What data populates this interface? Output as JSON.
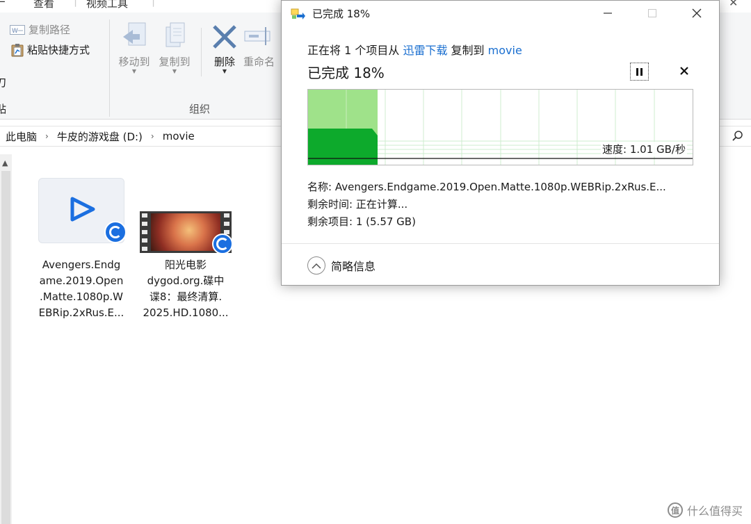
{
  "explorer": {
    "ribbon_tabs": [
      "查看",
      "视频工具"
    ],
    "ribbon": {
      "copy_path": "复制路径",
      "paste_shortcut": "粘贴快捷方式",
      "move_to": "移动到",
      "copy_to": "复制到",
      "delete": "删除",
      "rename": "重命名",
      "group_organize": "组织",
      "partial_left_1": "刀",
      "partial_left_2": "贴"
    },
    "breadcrumb": [
      "此电脑",
      "牛皮的游戏盘 (D:)",
      "movie"
    ],
    "files": [
      {
        "name": "Avengers.Endgame.2019.Open.Matte.1080p.WEBRip.2xRus.E...",
        "lines": [
          "Avengers.Endg",
          "ame.2019.Open",
          ".Matte.1080p.W",
          "EBRip.2xRus.E..."
        ],
        "icon": "media-player-play-icon"
      },
      {
        "name": "阳光电影dygod.org.碟中谍8：最终清算.2025.HD.1080...",
        "lines": [
          "阳光电影",
          "dygod.org.碟中",
          "谍8：最终清算.",
          "2025.HD.1080..."
        ],
        "icon": "video-thumbnail"
      }
    ]
  },
  "copy_dialog": {
    "title": "已完成 18%",
    "line_prefix": "正在将 1 个项目从 ",
    "source": "迅雷下载",
    "line_middle": " 复制到 ",
    "destination": "movie",
    "status": "已完成 18%",
    "percent": 18,
    "speed": "速度: 1.01 GB/秒",
    "name_label": "名称:",
    "name_value": "Avengers.Endgame.2019.Open.Matte.1080p.WEBRip.2xRus.E...",
    "time_label": "剩余时间:",
    "time_value": "正在计算...",
    "items_label": "剩余项目:",
    "items_value": "1 (5.57 GB)",
    "toggle_label": "简略信息"
  },
  "watermark": {
    "text": "什么值得买",
    "logo_char": "值"
  },
  "colors": {
    "progress_dark": "#0daa2c",
    "progress_light": "#9fe28a",
    "link": "#1a6fd0"
  }
}
